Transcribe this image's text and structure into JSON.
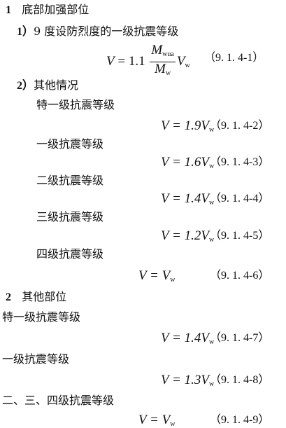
{
  "sections": {
    "s1": {
      "num": "1",
      "title": "底部加强部位"
    },
    "s1_1": {
      "num": "1）",
      "title": "9 度设防烈度的一级抗震等级"
    },
    "eq1": {
      "lhs": "V",
      "eq": " = 1.1 ",
      "num_M": "M",
      "num_sub": "wua",
      "den_M": "M",
      "den_sub": "w",
      "V": "V",
      "V_sub": "w",
      "tag": "（9. 1. 4-1）"
    },
    "s1_2": {
      "num": "2）",
      "title": "其他情况"
    },
    "a1": "特一级抗震等级",
    "eq2": {
      "text": "V = 1.9V",
      "sub": "w",
      "tag": "（9. 1. 4-2）"
    },
    "a2": "一级抗震等级",
    "eq3": {
      "text": "V = 1.6V",
      "sub": "w",
      "tag": "（9. 1. 4-3）"
    },
    "a3": "二级抗震等级",
    "eq4": {
      "text": "V = 1.4V",
      "sub": "w",
      "tag": "（9. 1. 4-4）"
    },
    "a4": "三级抗震等级",
    "eq5": {
      "text": "V = 1.2V",
      "sub": "w",
      "tag": "（9. 1. 4-5）"
    },
    "a5": "四级抗震等级",
    "eq6": {
      "text": "V = V",
      "sub": "w",
      "tag": "（9. 1. 4-6）"
    },
    "s2": {
      "num": "2",
      "title": "其他部位"
    },
    "b1": "特一级抗震等级",
    "eq7": {
      "text": "V = 1.4V",
      "sub": "w",
      "tag": "（9. 1. 4-7）"
    },
    "b2": "一级抗震等级",
    "eq8": {
      "text": "V = 1.3V",
      "sub": "w",
      "tag": "（9. 1. 4-8）"
    },
    "b3": "二、三、四级抗震等级",
    "eq9": {
      "text": "V = V",
      "sub": "w",
      "tag": "（9. 1. 4-9）"
    }
  }
}
